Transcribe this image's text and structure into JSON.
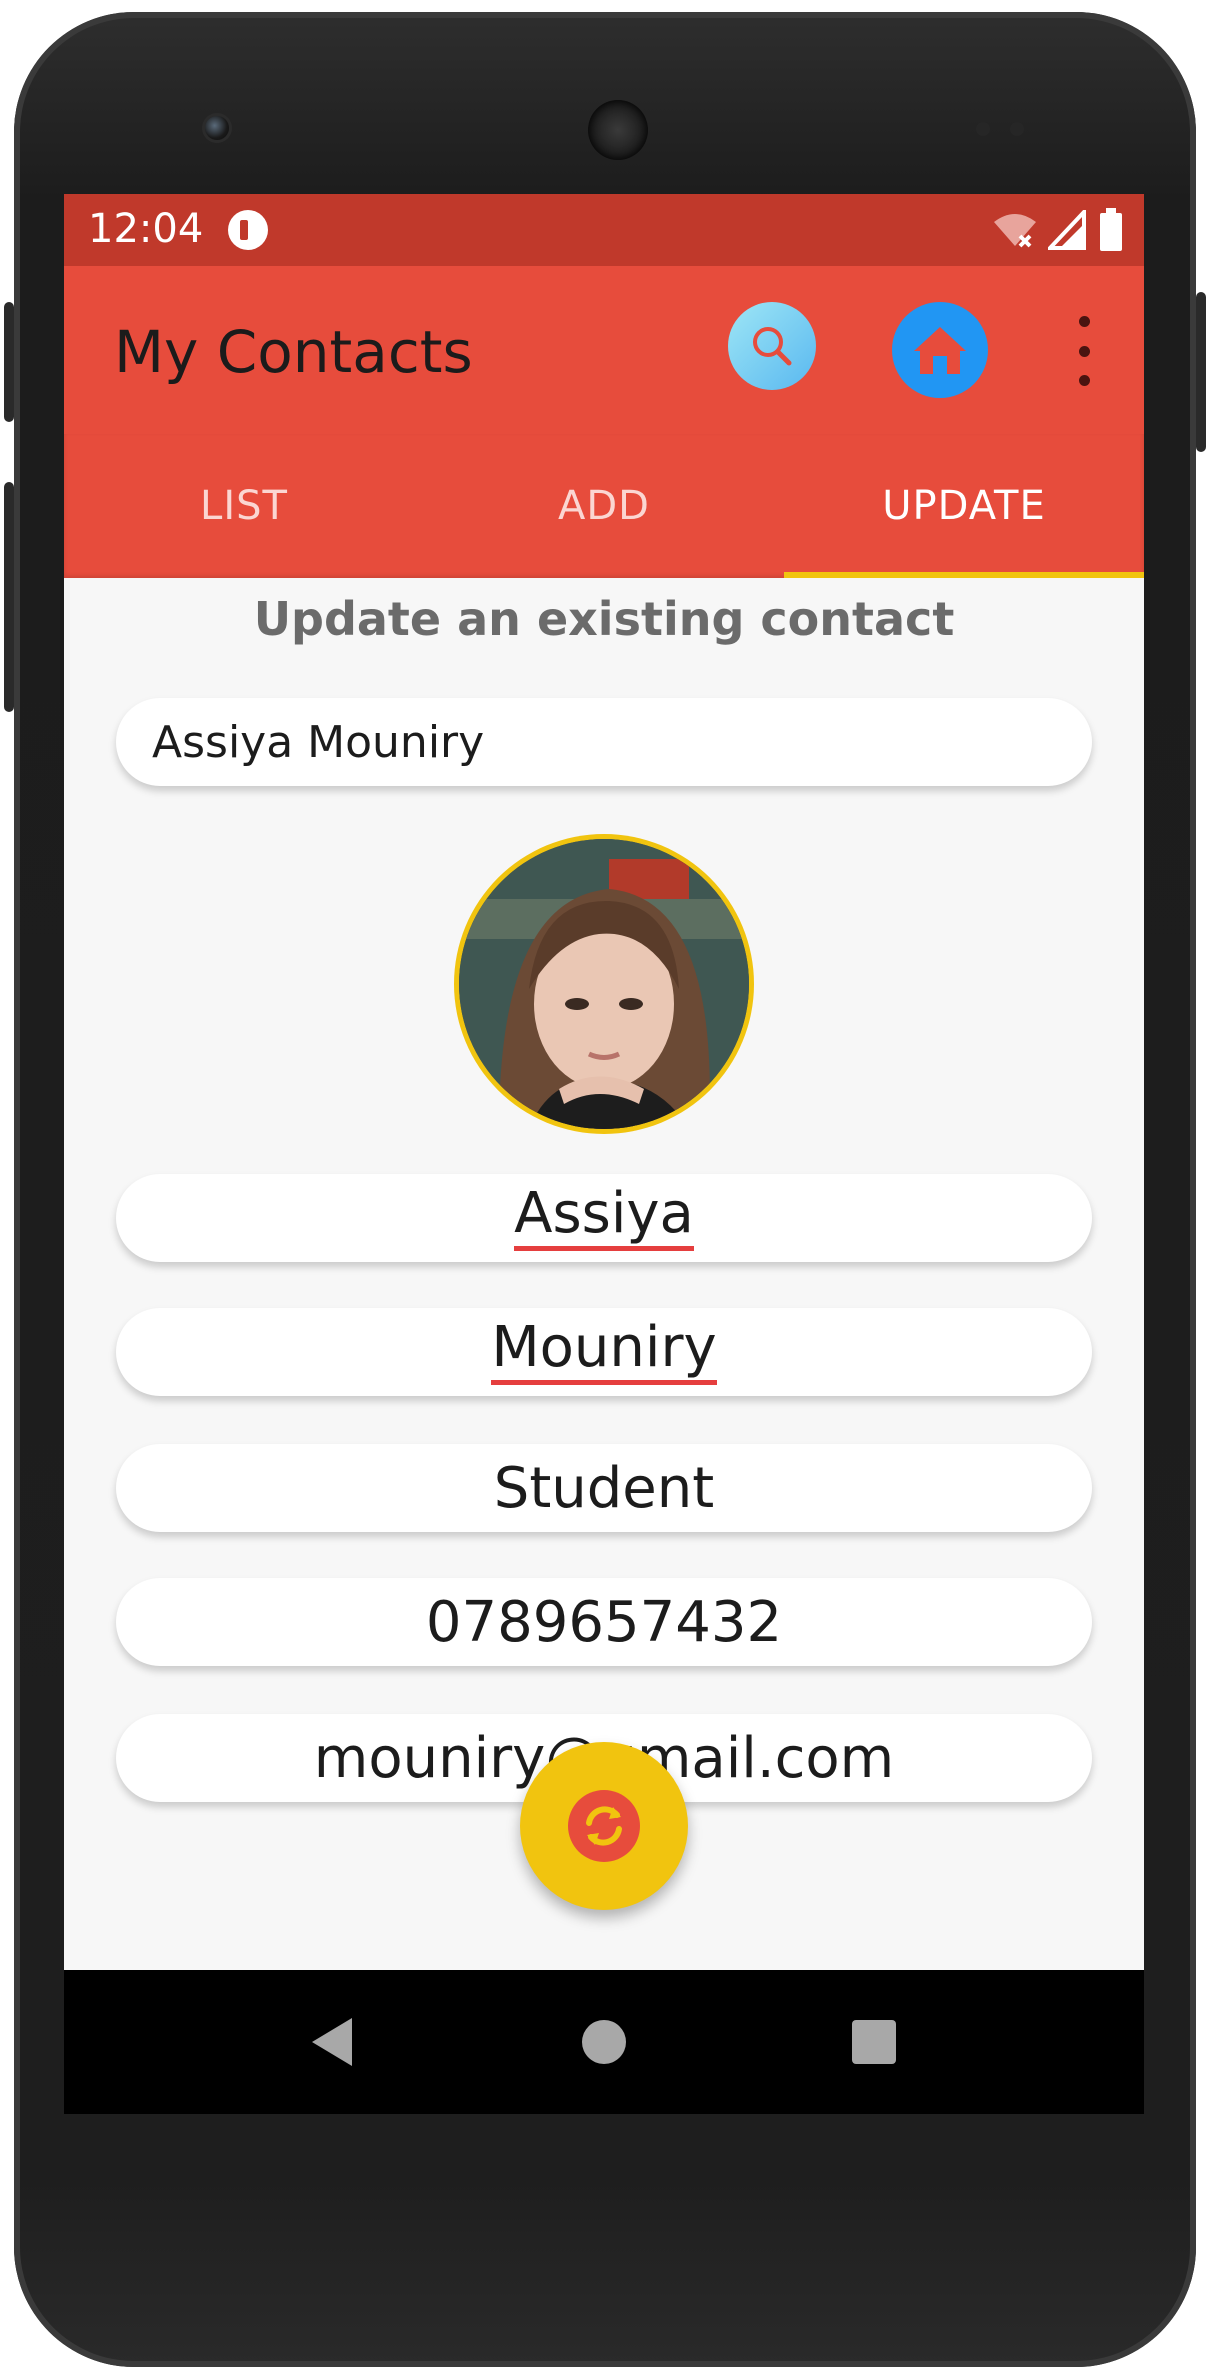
{
  "status_bar": {
    "time": "12:04"
  },
  "app_bar": {
    "title": "My Contacts"
  },
  "tabs": [
    {
      "label": "LIST",
      "active": false
    },
    {
      "label": "ADD",
      "active": false
    },
    {
      "label": "UPDATE",
      "active": true
    }
  ],
  "form": {
    "section_title": "Update an existing contact",
    "search_value": "Assiya Mouniry",
    "first_name": "Assiya",
    "last_name": "Mouniry",
    "job": "Student",
    "phone": "0789657432",
    "email": "mouniry@gmail.com"
  },
  "colors": {
    "status_bar": "#c0392b",
    "app_bar": "#e74c3c",
    "tab_indicator": "#f1c40f",
    "fab": "#f1c40f",
    "home_button": "#2196f3"
  },
  "icons": {
    "search": "search-icon",
    "home": "home-icon",
    "overflow": "more-vert-icon",
    "fab": "refresh-icon"
  }
}
